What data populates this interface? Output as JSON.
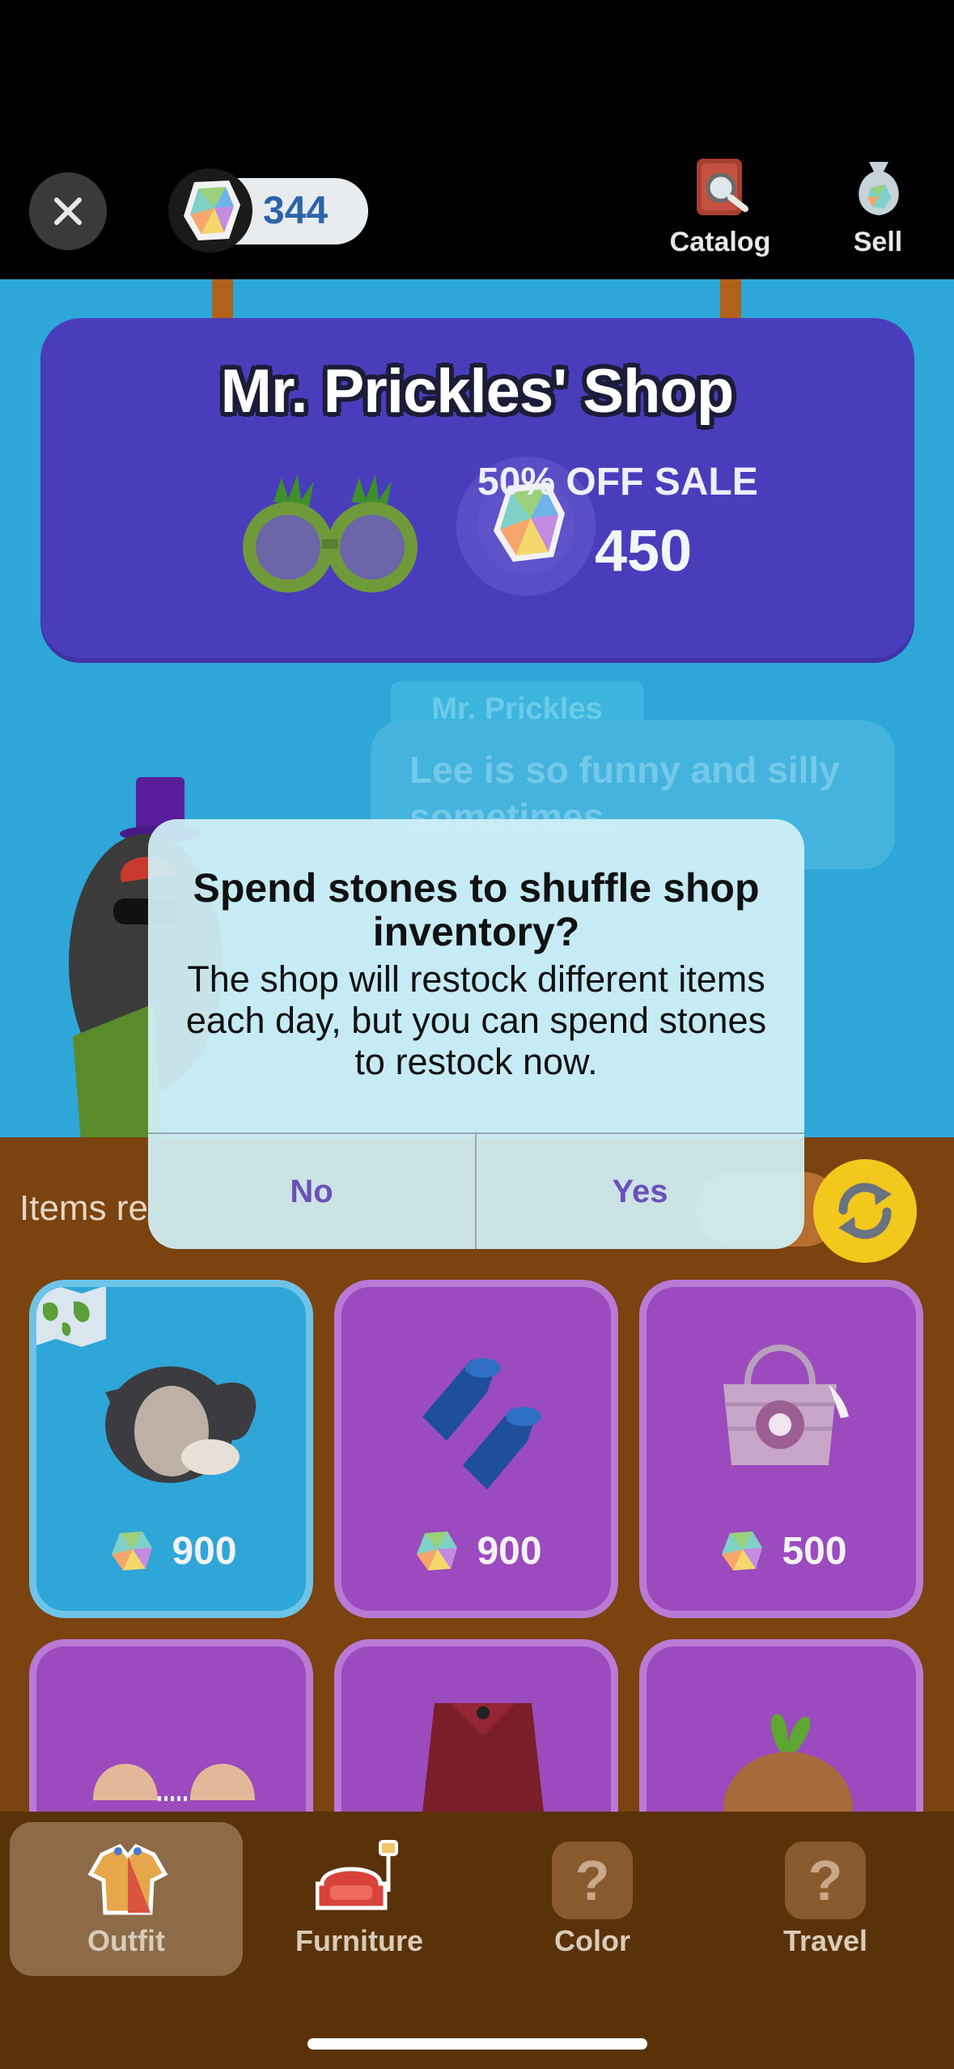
{
  "topbar": {
    "close_icon": "close-icon",
    "stone_count": "344",
    "catalog_label": "Catalog",
    "sell_label": "Sell"
  },
  "sign": {
    "title": "Mr. Prickles' Shop",
    "sale_label": "50% OFF SALE",
    "sale_price": "450"
  },
  "npc": {
    "name": "Mr. Prickles",
    "speech": "Lee is so funny and silly sometimes."
  },
  "shop": {
    "items_label": "Items re",
    "items": [
      {
        "name": "penguin-outfit",
        "price": "900",
        "color": "#2ea6d8"
      },
      {
        "name": "blue-flippers",
        "price": "900",
        "color": "#9b4bbd"
      },
      {
        "name": "hibiscus-tote-bag",
        "price": "500",
        "color": "#9b4bbd"
      }
    ]
  },
  "dialog": {
    "title": "Spend stones to shuffle shop inventory?",
    "message": "The shop will restock different items each day, but you can spend stones to restock now.",
    "no_label": "No",
    "yes_label": "Yes"
  },
  "nav": {
    "tabs": [
      {
        "label": "Outfit",
        "active": true
      },
      {
        "label": "Furniture",
        "active": false
      },
      {
        "label": "Color",
        "active": false
      },
      {
        "label": "Travel",
        "active": false
      }
    ],
    "locked_glyph": "?"
  },
  "colors": {
    "scene_blue": "#2ea6d8",
    "sign_purple": "#4a3dbb",
    "shop_brown": "#7a430f",
    "card_purple": "#9b4bbd",
    "refresh_yellow": "#f2c81c",
    "dialog_button": "#6b50b8"
  }
}
